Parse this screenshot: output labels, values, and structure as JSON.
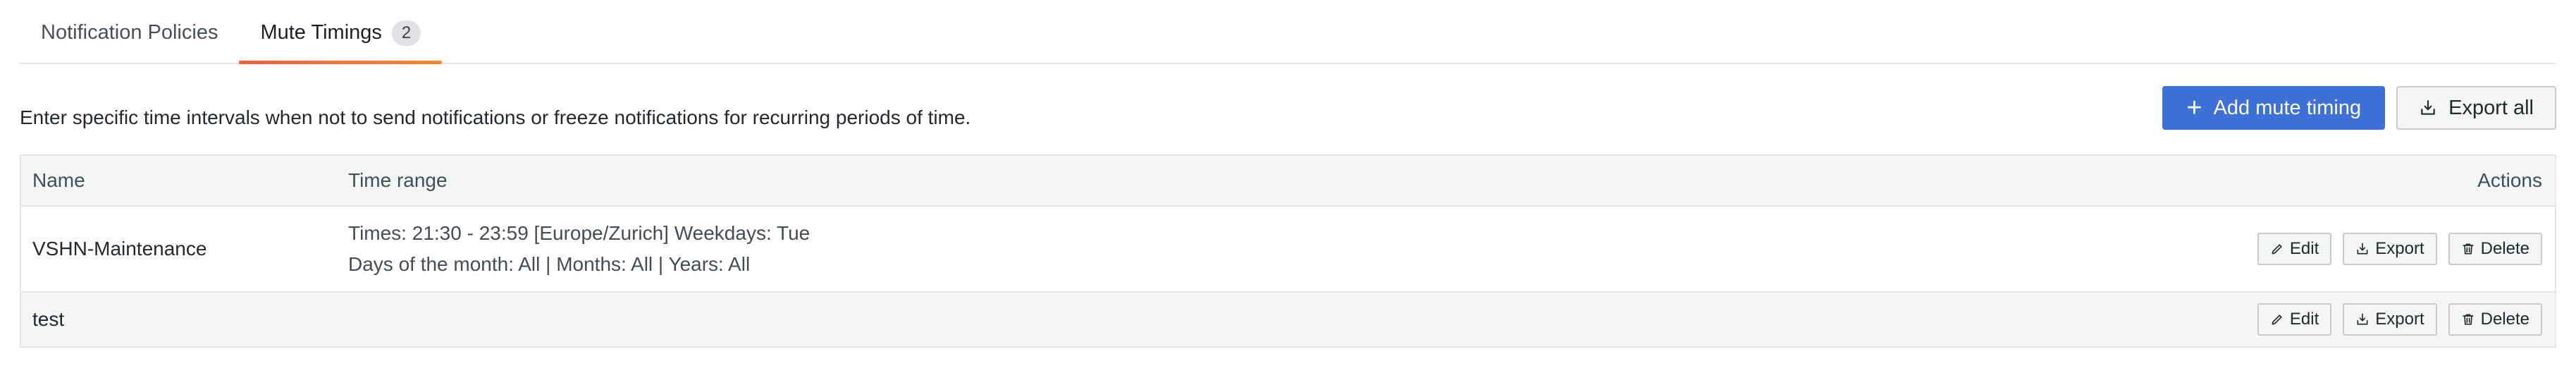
{
  "tabs": [
    {
      "label": "Notification Policies",
      "active": false
    },
    {
      "label": "Mute Timings",
      "count": "2",
      "active": true
    }
  ],
  "description": "Enter specific time intervals when not to send notifications or freeze notifications for recurring periods of time.",
  "toolbar": {
    "add_label": "Add mute timing",
    "export_all_label": "Export all"
  },
  "table": {
    "headers": {
      "name": "Name",
      "time_range": "Time range",
      "actions": "Actions"
    },
    "rows": [
      {
        "name": "VSHN-Maintenance",
        "time_line1": "Times: 21:30 - 23:59 [Europe/Zurich] Weekdays: Tue",
        "time_line2": "Days of the month: All | Months: All | Years: All",
        "edit": "Edit",
        "export": "Export",
        "delete": "Delete"
      },
      {
        "name": "test",
        "time_line1": "",
        "time_line2": "",
        "edit": "Edit",
        "export": "Export",
        "delete": "Delete"
      }
    ]
  },
  "colors": {
    "primary": "#3d71d9",
    "tab_active_underline": "#f55f3e"
  }
}
